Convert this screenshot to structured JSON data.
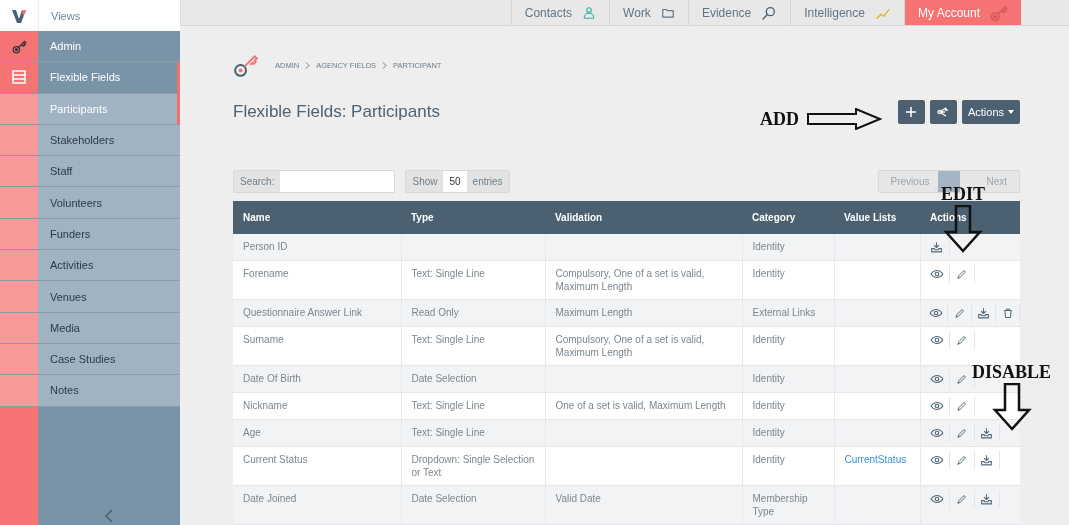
{
  "brand": {
    "views_label": "Views"
  },
  "sidebar": {
    "items": [
      {
        "label": "Admin",
        "kind": "section",
        "selected": false
      },
      {
        "label": "Flexible Fields",
        "kind": "section",
        "selected": true
      },
      {
        "label": "Participants",
        "kind": "sub",
        "selected": true
      },
      {
        "label": "Stakeholders",
        "kind": "sub",
        "selected": false
      },
      {
        "label": "Staff",
        "kind": "sub",
        "selected": false
      },
      {
        "label": "Volunteers",
        "kind": "sub",
        "selected": false
      },
      {
        "label": "Funders",
        "kind": "sub",
        "selected": false
      },
      {
        "label": "Activities",
        "kind": "sub",
        "selected": false
      },
      {
        "label": "Venues",
        "kind": "sub",
        "selected": false
      },
      {
        "label": "Media",
        "kind": "sub",
        "selected": false
      },
      {
        "label": "Case Studies",
        "kind": "sub",
        "selected": false
      },
      {
        "label": "Notes",
        "kind": "sub",
        "selected": false
      }
    ]
  },
  "top_nav": [
    {
      "label": "Contacts",
      "kind": "contacts",
      "selected": false
    },
    {
      "label": "Work",
      "kind": "work",
      "selected": false
    },
    {
      "label": "Evidence",
      "kind": "evidence",
      "selected": false
    },
    {
      "label": "Intelligence",
      "kind": "intelligence",
      "selected": false
    },
    {
      "label": "My Account",
      "kind": "account",
      "selected": true
    }
  ],
  "breadcrumb": [
    "ADMIN",
    "AGENCY FIELDS",
    "PARTICIPANT"
  ],
  "title": "Flexible Fields: Participants",
  "toolbar": {
    "actions_label": "Actions"
  },
  "search": {
    "label": "Search:"
  },
  "length": {
    "prefix": "Show",
    "value": "50",
    "suffix": "entries"
  },
  "pagination": {
    "previous": "Previous",
    "next": "Next",
    "current_selected": true
  },
  "table": {
    "columns": [
      "Name",
      "Type",
      "Validation",
      "Category",
      "Value Lists",
      "Actions"
    ],
    "rows": [
      {
        "name": "Person ID",
        "type": "",
        "validation": "",
        "category": "Identity",
        "value_list": "",
        "actions": [
          {
            "kind": "import"
          }
        ]
      },
      {
        "name": "Forename",
        "type": "Text: Single Line",
        "validation": "Compulsory, One of a set is valid, Maximum Length",
        "category": "Identity",
        "value_list": "",
        "actions": [
          {
            "kind": "view"
          },
          {
            "kind": "edit"
          }
        ]
      },
      {
        "name": "Questionnaire Answer Link",
        "type": "Read Only",
        "validation": "Maximum Length",
        "category": "External Links",
        "value_list": "",
        "actions": [
          {
            "kind": "view"
          },
          {
            "kind": "edit"
          },
          {
            "kind": "import"
          },
          {
            "kind": "delete"
          }
        ]
      },
      {
        "name": "Surname",
        "type": "Text: Single Line",
        "validation": "Compulsory, One of a set is valid, Maximum Length",
        "category": "Identity",
        "value_list": "",
        "actions": [
          {
            "kind": "view"
          },
          {
            "kind": "edit"
          }
        ]
      },
      {
        "name": "Date Of Birth",
        "type": "Date Selection",
        "validation": "",
        "category": "Identity",
        "value_list": "",
        "actions": [
          {
            "kind": "view"
          },
          {
            "kind": "edit"
          }
        ]
      },
      {
        "name": "Nickname",
        "type": "Text: Single Line",
        "validation": "One of a set is valid, Maximum Length",
        "category": "Identity",
        "value_list": "",
        "actions": [
          {
            "kind": "view"
          },
          {
            "kind": "edit"
          }
        ]
      },
      {
        "name": "Age",
        "type": "Text: Single Line",
        "validation": "",
        "category": "Identity",
        "value_list": "",
        "actions": [
          {
            "kind": "view"
          },
          {
            "kind": "edit"
          },
          {
            "kind": "import"
          }
        ]
      },
      {
        "name": "Current Status",
        "type": "Dropdown: Single Selection or Text",
        "validation": "",
        "category": "Identity",
        "value_list": "CurrentStatus",
        "actions": [
          {
            "kind": "view"
          },
          {
            "kind": "edit"
          },
          {
            "kind": "import"
          }
        ]
      },
      {
        "name": "Date Joined",
        "type": "Date Selection",
        "validation": "Valid Date",
        "category": "Membership Type",
        "value_list": "",
        "actions": [
          {
            "kind": "view"
          },
          {
            "kind": "edit"
          },
          {
            "kind": "import"
          }
        ]
      }
    ]
  },
  "annotations": [
    {
      "kind": "arrow-right",
      "label": "ADD"
    },
    {
      "kind": "arrow-down",
      "label": "EDIT"
    },
    {
      "kind": "arrow-down",
      "label": "DISABLE"
    }
  ]
}
